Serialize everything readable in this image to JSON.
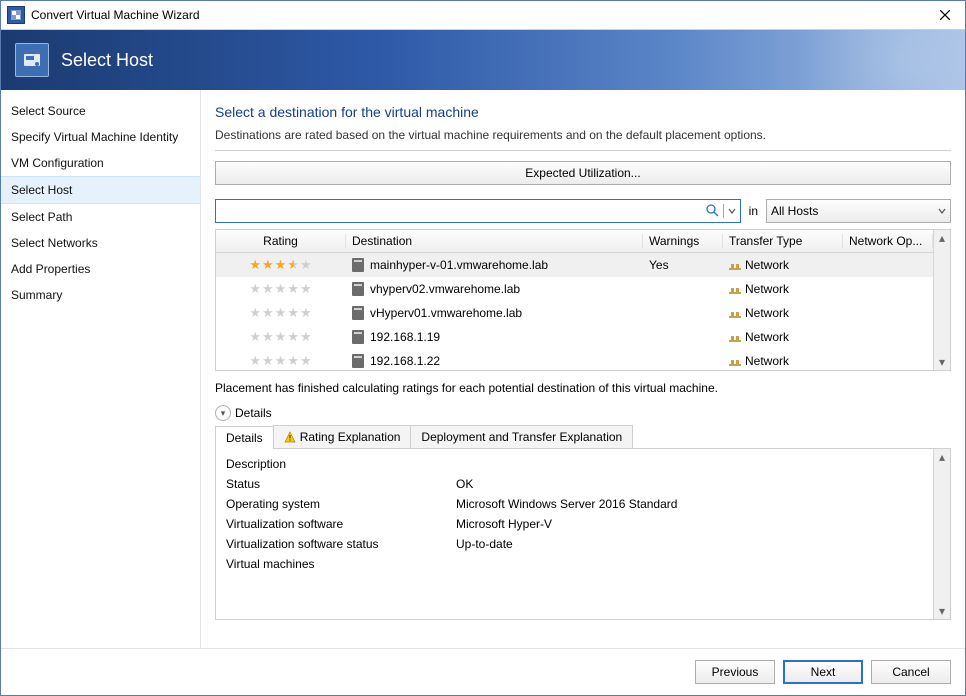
{
  "window": {
    "title": "Convert Virtual Machine Wizard"
  },
  "banner": {
    "title": "Select Host"
  },
  "sidebar": {
    "items": [
      {
        "label": "Select Source"
      },
      {
        "label": "Specify Virtual Machine Identity"
      },
      {
        "label": "VM Configuration"
      },
      {
        "label": "Select Host"
      },
      {
        "label": "Select Path"
      },
      {
        "label": "Select Networks"
      },
      {
        "label": "Add Properties"
      },
      {
        "label": "Summary"
      }
    ],
    "active_index": 3
  },
  "main": {
    "heading": "Select a destination for the virtual machine",
    "subheading": "Destinations are rated based on the virtual machine requirements and on the default placement options.",
    "expected_btn": "Expected Utilization...",
    "search_value": "",
    "in_label": "in",
    "host_scope": "All Hosts",
    "columns": {
      "rating": "Rating",
      "destination": "Destination",
      "warnings": "Warnings",
      "transfer": "Transfer Type",
      "network": "Network Op..."
    },
    "rows": [
      {
        "rating": 3.5,
        "destination": "mainhyper-v-01.vmwarehome.lab",
        "warnings": "Yes",
        "transfer": "Network",
        "network": ""
      },
      {
        "rating": 0,
        "destination": "vhyperv02.vmwarehome.lab",
        "warnings": "",
        "transfer": "Network",
        "network": ""
      },
      {
        "rating": 0,
        "destination": "vHyperv01.vmwarehome.lab",
        "warnings": "",
        "transfer": "Network",
        "network": ""
      },
      {
        "rating": 0,
        "destination": "192.168.1.19",
        "warnings": "",
        "transfer": "Network",
        "network": ""
      },
      {
        "rating": 0,
        "destination": "192.168.1.22",
        "warnings": "",
        "transfer": "Network",
        "network": ""
      }
    ],
    "selected_row": 0,
    "placement_msg": "Placement has finished calculating ratings for each potential destination of this virtual machine."
  },
  "details": {
    "toggle_label": "Details",
    "tabs": [
      {
        "label": "Details"
      },
      {
        "label": "Rating Explanation",
        "warn": true
      },
      {
        "label": "Deployment and Transfer Explanation"
      }
    ],
    "active_tab": 0,
    "description_label": "Description",
    "fields": [
      {
        "label": "Status",
        "value": "OK"
      },
      {
        "label": "Operating system",
        "value": "Microsoft Windows Server 2016 Standard"
      },
      {
        "label": "Virtualization software",
        "value": "Microsoft Hyper-V"
      },
      {
        "label": "Virtualization software status",
        "value": "Up-to-date"
      },
      {
        "label": "Virtual machines",
        "value": ""
      }
    ]
  },
  "footer": {
    "previous": "Previous",
    "next": "Next",
    "cancel": "Cancel"
  }
}
